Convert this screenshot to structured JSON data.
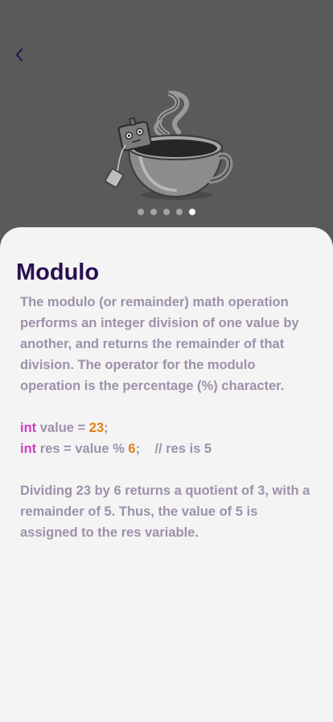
{
  "lesson": {
    "title": "Modulo",
    "intro": "The modulo (or remainder) math operation performs an integer division of one value by another, and returns the remainder of that division. The operator for the modulo operation is the percentage (%) character.",
    "code": {
      "line1": {
        "keyword": "int",
        "text": " value = ",
        "number": "23",
        "end": ";"
      },
      "line2": {
        "keyword": "int",
        "text": " res = value % ",
        "number": "6",
        "end": ";",
        "comment": "    // res is 5"
      }
    },
    "explanation": "Dividing 23 by 6 returns a quotient of 3, with a remainder of 5. Thus, the value of 5 is assigned to the res variable."
  },
  "pager": {
    "total": 5,
    "active": 5
  },
  "icons": {
    "back": "chevron-left-icon",
    "illustration": "coffee-cup-robot-illustration"
  },
  "colors": {
    "header_bg": "#5a5a5a",
    "card_bg": "#f4f4f4",
    "title": "#2a0f52",
    "body": "#9d91ab",
    "keyword": "#d63bc2",
    "number": "#e0820f"
  }
}
